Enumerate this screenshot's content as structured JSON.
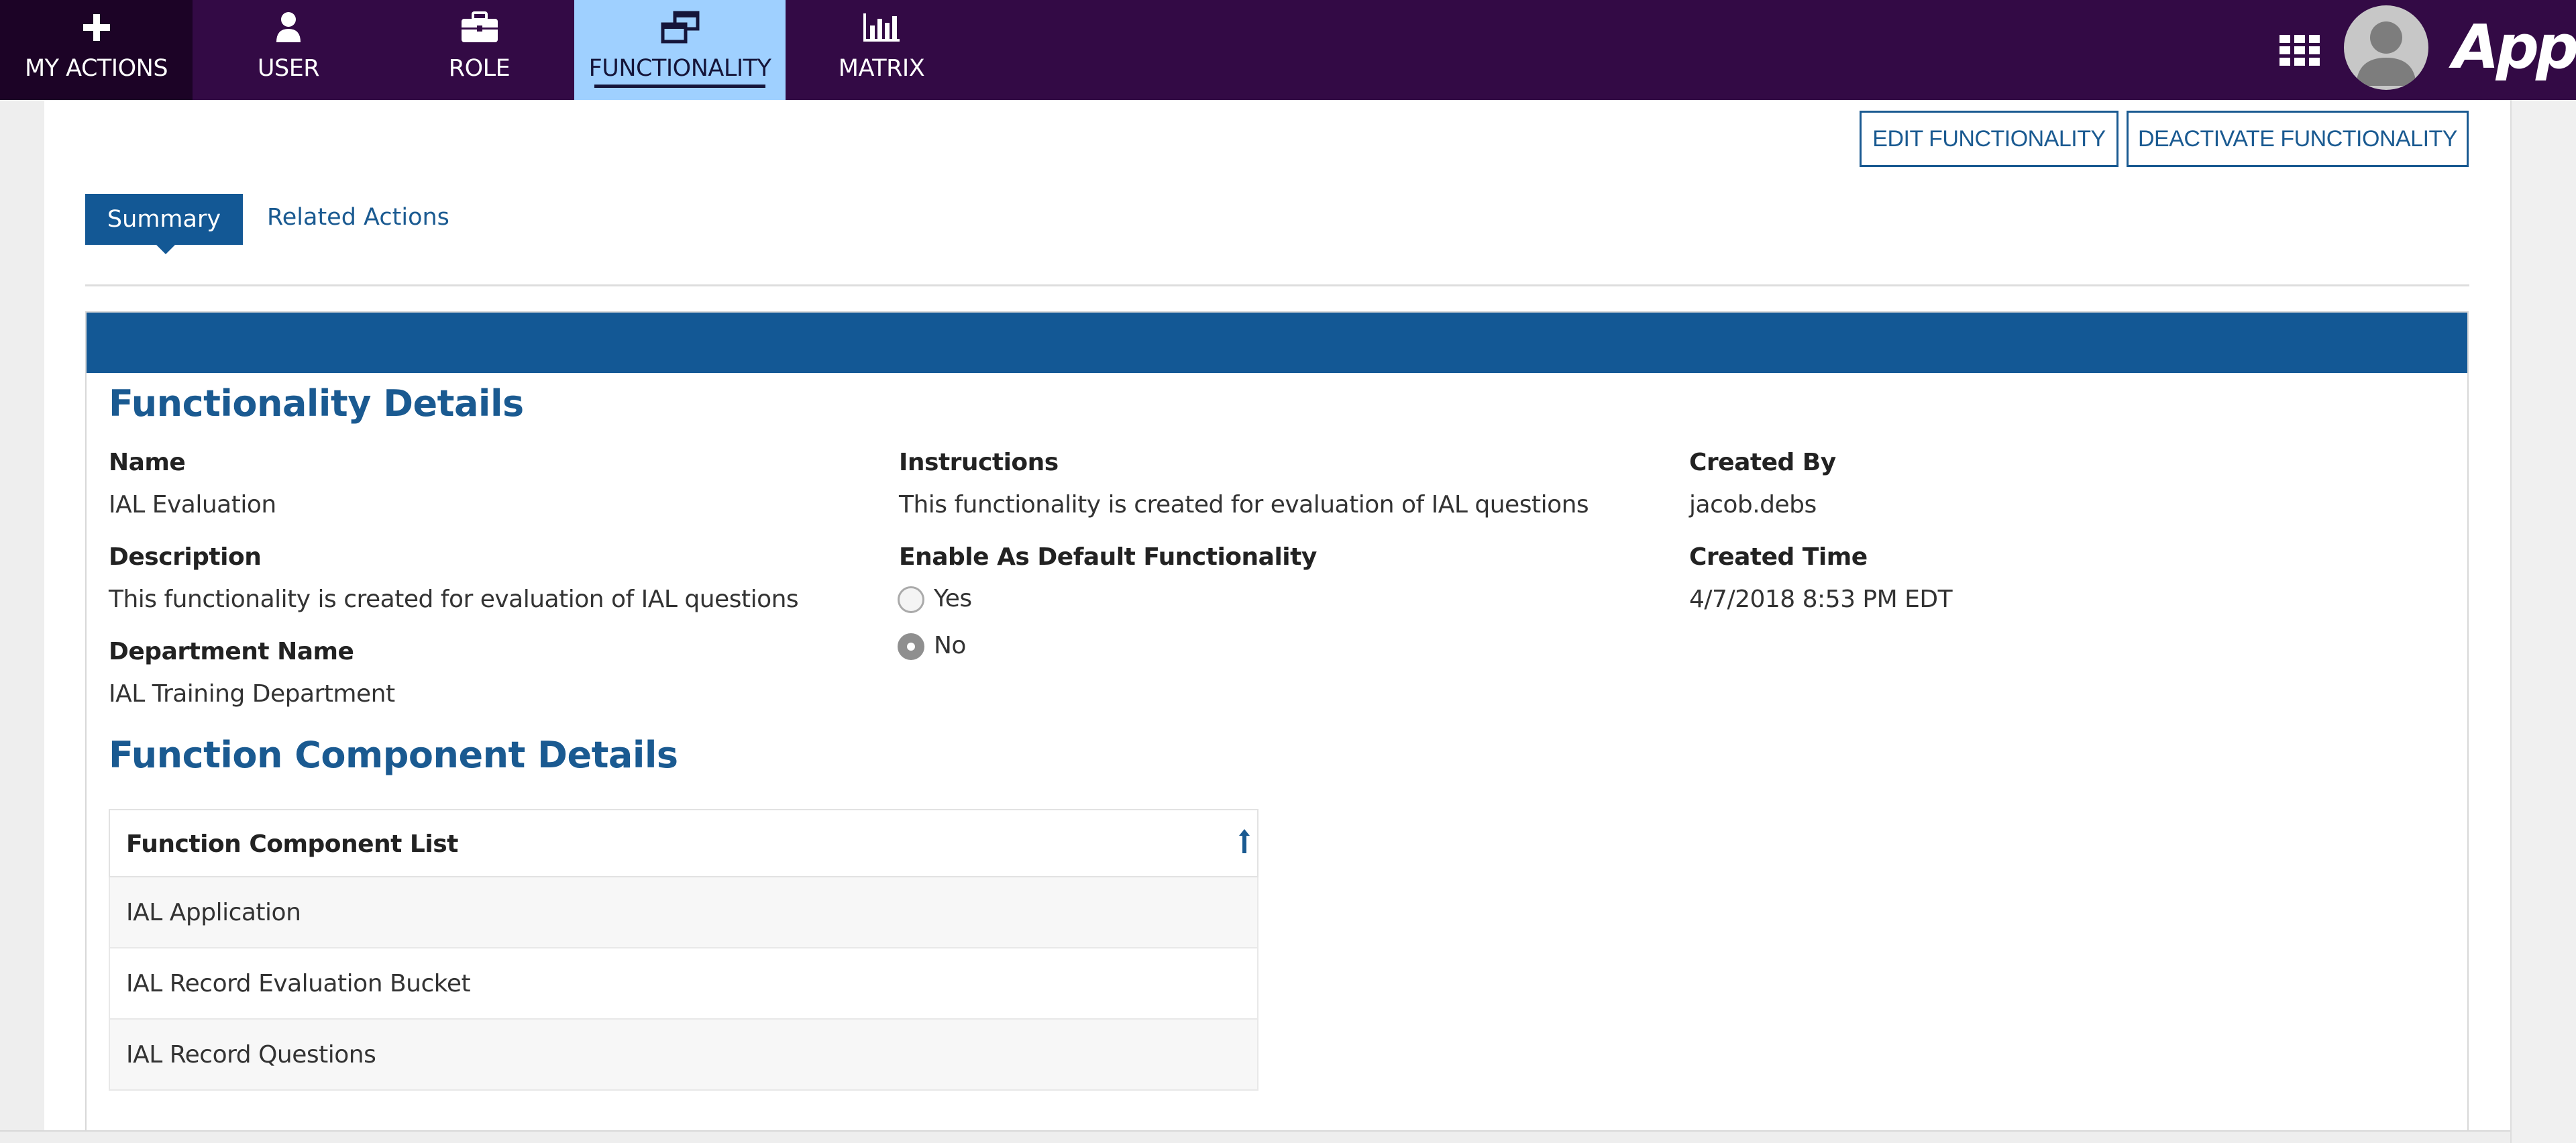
{
  "nav": {
    "tabs": [
      {
        "label": "MY ACTIONS",
        "icon": "plus-icon"
      },
      {
        "label": "USER",
        "icon": "user-icon"
      },
      {
        "label": "ROLE",
        "icon": "briefcase-icon"
      },
      {
        "label": "FUNCTIONALITY",
        "icon": "windows-icon",
        "active": true
      },
      {
        "label": "MATRIX",
        "icon": "bar-chart-icon"
      }
    ],
    "brand": "Appian",
    "colors": {
      "bar": "#330a45",
      "active_tab": "#9fd0ff",
      "my_actions": "#1c0326"
    }
  },
  "toolbar": {
    "edit_label": "EDIT FUNCTIONALITY",
    "deactivate_label": "DEACTIVATE FUNCTIONALITY"
  },
  "tabs": {
    "summary": "Summary",
    "related_actions": "Related Actions"
  },
  "details": {
    "heading": "Functionality Details",
    "name_label": "Name",
    "name_value": "IAL Evaluation",
    "description_label": "Description",
    "description_value": "This functionality is created for evaluation of IAL questions",
    "department_label": "Department Name",
    "department_value": "IAL Training Department",
    "instructions_label": "Instructions",
    "instructions_value": "This functionality is created for evaluation of IAL questions",
    "default_label": "Enable As Default Functionality",
    "default_options": [
      "Yes",
      "No"
    ],
    "default_selected": "No",
    "created_by_label": "Created By",
    "created_by_value": "jacob.debs",
    "created_time_label": "Created Time",
    "created_time_value": "4/7/2018 8:53 PM EDT"
  },
  "components": {
    "heading": "Function Component Details",
    "column_header": "Function Component List",
    "rows": [
      "IAL Application",
      "IAL Record Evaluation Bucket",
      "IAL Record Questions"
    ]
  },
  "accent": "#1a5a91"
}
